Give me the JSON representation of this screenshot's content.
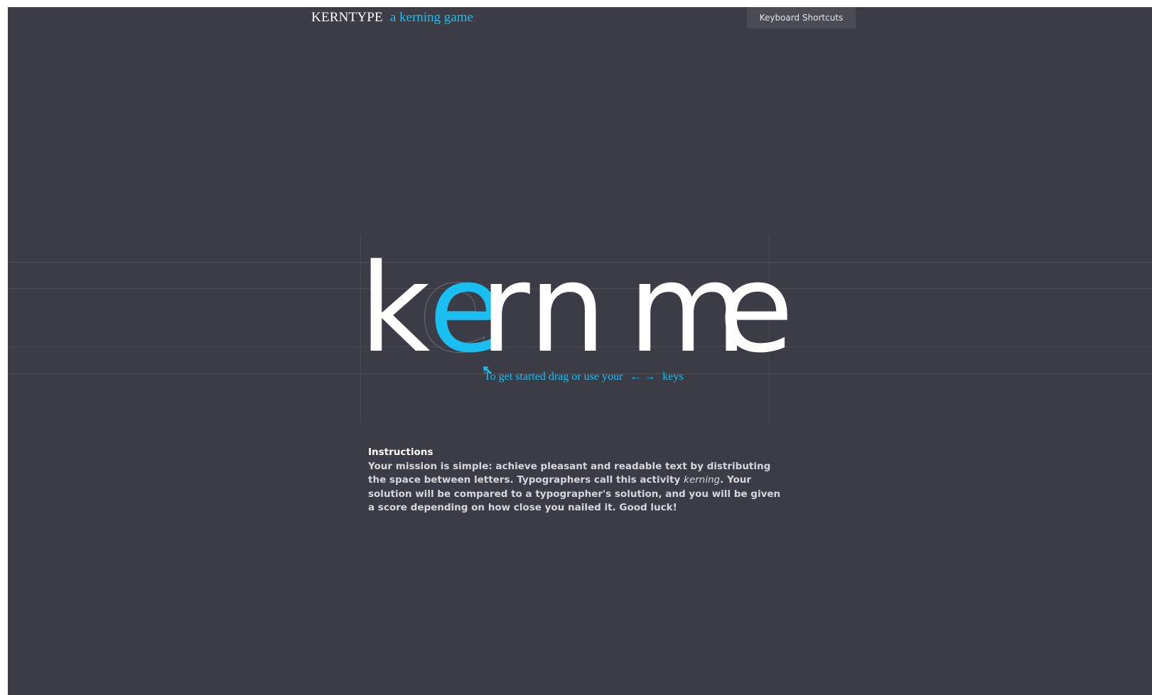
{
  "header": {
    "brand_name": "KERNTYPE",
    "brand_tagline": "a kerning game",
    "shortcuts_label": "Keyboard Shortcuts"
  },
  "puzzle": {
    "letters": [
      "k",
      "e",
      "r",
      "n",
      "m",
      "e"
    ],
    "active_letter": "e",
    "ghost_letter": "e",
    "hint_text": "To get started drag or use your",
    "hint_arrows": "← →",
    "hint_keys": "keys"
  },
  "instructions": {
    "heading": "Instructions",
    "text_before": "Your mission is simple: achieve pleasant and readable text by distributing the space between letters. Typographers call this activity ",
    "emphasis": "kerning",
    "text_after": ". Your solution will be compared to a typographer's solution, and you will be given a score depending on how close you nailed it. Good luck!"
  },
  "colors": {
    "background": "#3c3c46",
    "accent": "#18bff0",
    "letter": "#ffffff",
    "guide": "#4b4b56"
  }
}
